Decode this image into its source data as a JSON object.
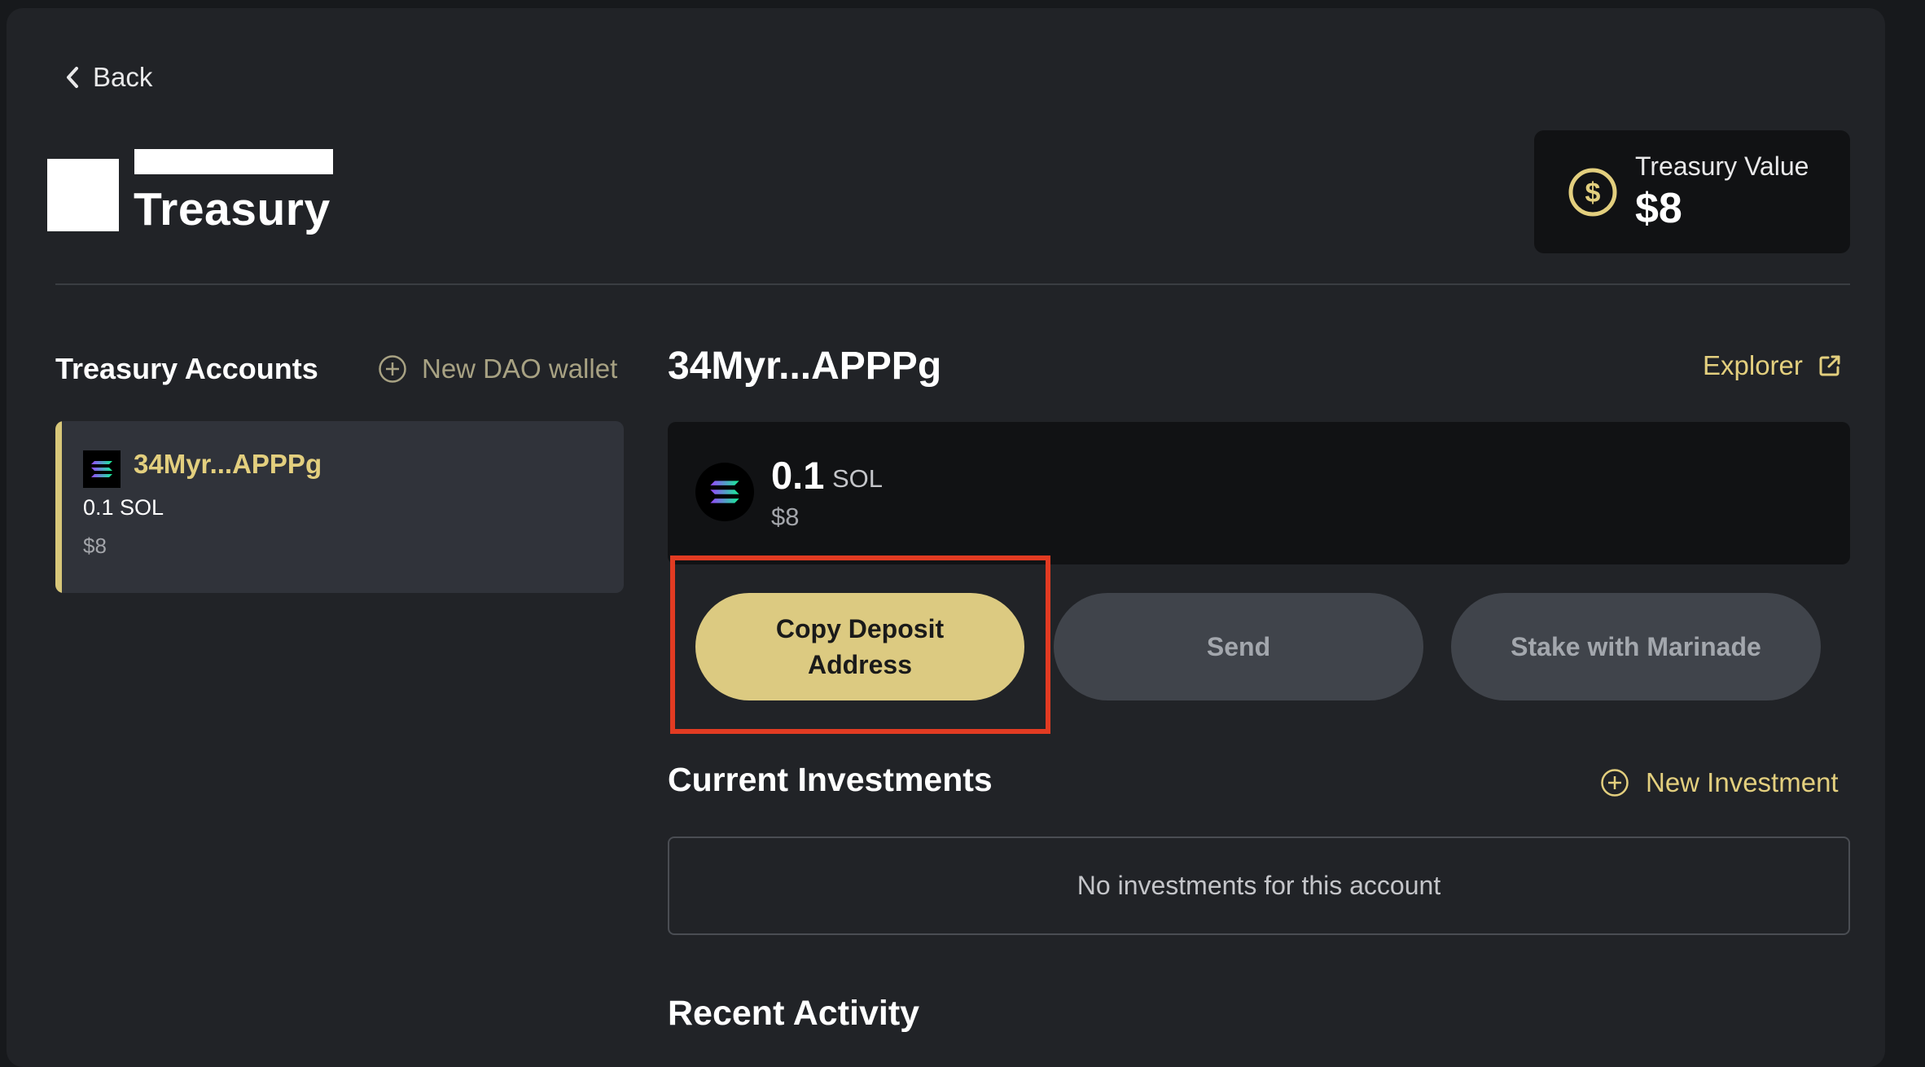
{
  "nav": {
    "back_label": "Back"
  },
  "header": {
    "title": "Treasury",
    "treasury_value_label": "Treasury Value",
    "treasury_value": "$8"
  },
  "sidebar": {
    "title": "Treasury Accounts",
    "new_wallet_label": "New DAO wallet",
    "accounts": [
      {
        "name": "34Myr...APPPg",
        "balance": "0.1 SOL",
        "usd": "$8",
        "selected": true
      }
    ]
  },
  "account": {
    "name": "34Myr...APPPg",
    "explorer_label": "Explorer",
    "token": {
      "amount": "0.1",
      "symbol": "SOL",
      "usd": "$8",
      "icon": "solana-icon"
    }
  },
  "actions": {
    "copy_deposit_label": "Copy Deposit Address",
    "send_label": "Send",
    "stake_label": "Stake with Marinade"
  },
  "investments": {
    "title": "Current Investments",
    "new_label": "New Investment",
    "empty_text": "No investments for this account"
  },
  "activity": {
    "title": "Recent Activity"
  },
  "colors": {
    "background": "#212327",
    "accent": "#e3cf7e",
    "primary_button": "#dcca81",
    "secondary_button": "#40444b",
    "highlight": "#e23b22"
  }
}
